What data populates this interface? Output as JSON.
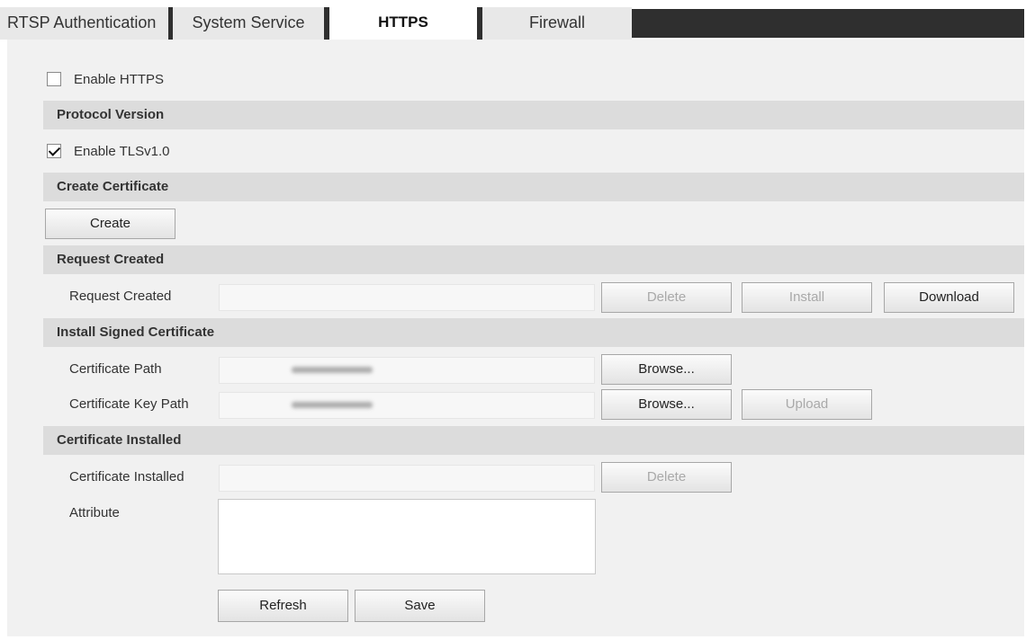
{
  "tabs": [
    {
      "label": "RTSP Authentication",
      "active": false
    },
    {
      "label": "System Service",
      "active": false
    },
    {
      "label": "HTTPS",
      "active": true
    },
    {
      "label": "Firewall",
      "active": false
    }
  ],
  "enable_https": {
    "label": "Enable HTTPS",
    "checked": false
  },
  "protocol_version": {
    "title": "Protocol Version",
    "enable_tls": {
      "label": "Enable TLSv1.0",
      "checked": true
    }
  },
  "create_certificate": {
    "title": "Create Certificate",
    "create_label": "Create"
  },
  "request_created": {
    "title": "Request Created",
    "field_label": "Request Created",
    "value": "",
    "delete_label": "Delete",
    "install_label": "Install",
    "download_label": "Download"
  },
  "install_signed": {
    "title": "Install Signed Certificate",
    "cert_path_label": "Certificate Path",
    "cert_key_path_label": "Certificate Key Path",
    "browse_label": "Browse...",
    "upload_label": "Upload"
  },
  "certificate_installed": {
    "title": "Certificate Installed",
    "field_label": "Certificate Installed",
    "value": "",
    "delete_label": "Delete",
    "attribute_label": "Attribute",
    "attribute_value": ""
  },
  "footer": {
    "refresh_label": "Refresh",
    "save_label": "Save"
  },
  "colors": {
    "tab_dark": "#2f2f2f",
    "panel_bg": "#f1f1f1",
    "section_bg": "#dcdcdc",
    "disabled_text": "#a9a9a9"
  }
}
